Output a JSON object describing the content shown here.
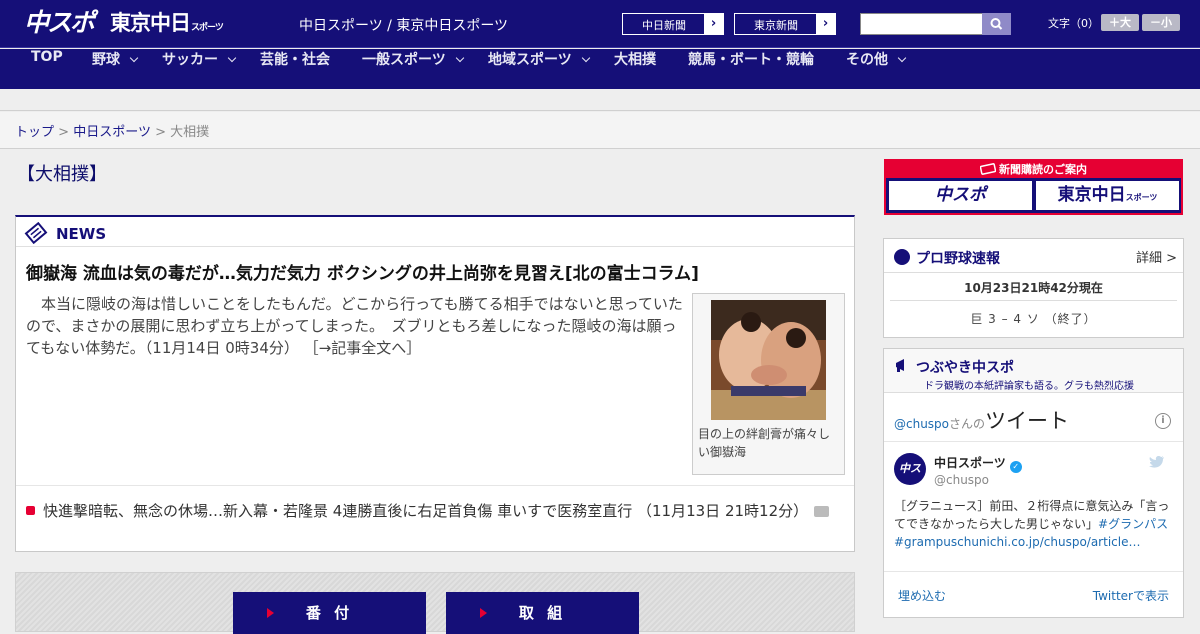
{
  "header": {
    "logo_chuspo": "中スポ",
    "logo_tokyo": "東京中日",
    "logo_tokyo_suffix": "スポーツ",
    "site_name": "中日スポーツ / 東京中日スポーツ",
    "ext_links": [
      {
        "label": "中日新聞",
        "arrow": "›"
      },
      {
        "label": "東京新聞",
        "arrow": "›"
      }
    ],
    "search": {
      "value": "",
      "icon": "search-icon"
    },
    "font_size_label": "文字（0）",
    "font_increase": "＋大",
    "font_decrease": "－小"
  },
  "nav": {
    "items": [
      {
        "label": "TOP",
        "dropdown": false
      },
      {
        "label": "野球",
        "dropdown": true
      },
      {
        "label": "サッカー",
        "dropdown": true
      },
      {
        "label": "芸能・社会",
        "dropdown": false
      },
      {
        "label": "一般スポーツ",
        "dropdown": true
      },
      {
        "label": "地域スポーツ",
        "dropdown": true
      },
      {
        "label": "大相撲",
        "dropdown": false
      },
      {
        "label": "競馬・ボート・競輪",
        "dropdown": false
      },
      {
        "label": "その他",
        "dropdown": true
      }
    ]
  },
  "breadcrumb": {
    "items": [
      "トップ",
      "中日スポーツ",
      "大相撲"
    ],
    "separator": ">"
  },
  "page_title": "【大相撲】",
  "news": {
    "section_label": "NEWS",
    "headline": "御嶽海 流血は気の毒だが…気力だ気力 ボクシングの井上尚弥を見習え[北の富士コラム]",
    "body": "　本当に隠岐の海は惜しいことをしたもんだ。どこから行っても勝てる相手ではないと思っていたので、まさかの展開に思わず立ち上がってしまった。　ズブリともろ差しになった隠岐の海は願ってもない体勢だ。（11月14日 0時34分）",
    "read_more": "［→記事全文へ］",
    "photo_caption": "目の上の絆創膏が痛々しい御嶽海",
    "item2": "快進撃暗転、無念の休場…新入幕・若隆景 4連勝直後に右足首負傷 車いすで医務室直行 （11月13日 21時12分）"
  },
  "tabs": [
    "番 付",
    "取 組"
  ],
  "sidebar": {
    "ad": {
      "title": "新聞購読のご案内",
      "logo1": "中スポ",
      "logo2": "東京中日",
      "logo2_suffix": "スポーツ"
    },
    "baseball": {
      "title": "プロ野球速報",
      "detail": "詳細 >",
      "time": "10月23日21時42分現在",
      "score": "巨 3 – 4 ソ （終了）"
    },
    "tweets": {
      "title": "つぶやき中スポ",
      "subtitle": "ドラ観戦の本紙評論家も語る。グラも熱烈応援",
      "user_handle_prefix": "@chuspo",
      "user_san": "さんの",
      "user_tweet": "ツイート",
      "name": "中日スポーツ",
      "handle": "@chuspo",
      "text": "［グラニュース］前田、２桁得点に意気込み「言ってできなかったら大した男じゃない」",
      "hashtag": "#グランパス",
      "url": "#grampuschunichi.co.jp/chuspo/article…",
      "embed": "埋め込む",
      "view": "Twitterで表示"
    }
  },
  "colors": {
    "navy": "#150f78",
    "accent_red": "#e60033",
    "link_blue": "#1d6bb0"
  }
}
